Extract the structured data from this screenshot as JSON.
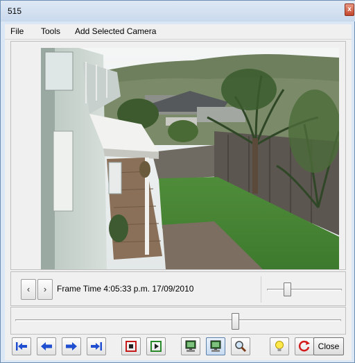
{
  "window": {
    "title": "515",
    "close_glyph": "x"
  },
  "menu": {
    "items": [
      "File",
      "Tools",
      "Add Selected Camera"
    ]
  },
  "frame": {
    "prev_label": "‹",
    "next_label": "›",
    "time_text": "Frame Time 4:05:33 p.m.  17/09/2010"
  },
  "zoom": {
    "level": 0.25
  },
  "timeline": {
    "position": 0.68
  },
  "toolbar": {
    "buttons": [
      {
        "name": "first-frame-icon"
      },
      {
        "name": "previous-frame-icon"
      },
      {
        "name": "next-frame-icon"
      },
      {
        "name": "last-frame-icon"
      },
      {
        "name": "stop-icon"
      },
      {
        "name": "play-icon"
      },
      {
        "name": "monitor-icon"
      },
      {
        "name": "monitor-active-icon"
      },
      {
        "name": "zoom-icon"
      },
      {
        "name": "bulb-icon"
      },
      {
        "name": "refresh-icon"
      }
    ],
    "close_label": "Close"
  },
  "colors": {
    "accent_blue": "#1f4fd0",
    "record_red": "#c41a1a",
    "play_green": "#2a8a2a",
    "window_frame": "#dbe7f4"
  }
}
